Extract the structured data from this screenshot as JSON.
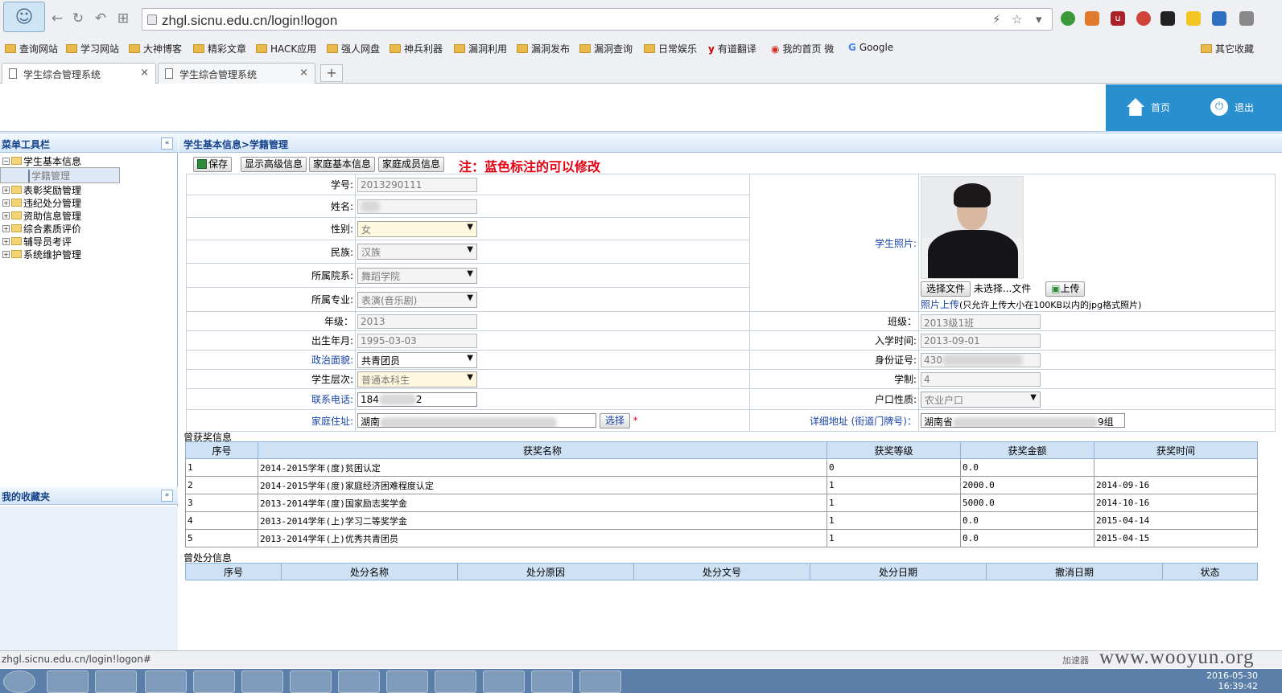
{
  "browser": {
    "url": "zhgl.sicnu.edu.cn/login!logon",
    "bookmarks": [
      "查询网站",
      "学习网站",
      "大神博客",
      "精彩文章",
      "HACK应用",
      "强人网盘",
      "神兵利器",
      "漏洞利用",
      "漏洞发布",
      "漏洞查询",
      "日常娱乐",
      "有道翻译",
      "我的首页 微",
      "Google",
      "其它收藏"
    ],
    "tabs": [
      {
        "title": "学生综合管理系统",
        "close": "×"
      },
      {
        "title": "学生综合管理系统",
        "close": "×"
      }
    ],
    "new_tab": "+"
  },
  "header": {
    "home_label": "首页",
    "logout_label": "退出"
  },
  "sidebar": {
    "title": "菜单工具栏",
    "tree": [
      {
        "label": "学生基本信息",
        "expanded": true,
        "children": [
          {
            "label": "学籍管理"
          }
        ]
      },
      {
        "label": "表彰奖励管理"
      },
      {
        "label": "违纪处分管理"
      },
      {
        "label": "资助信息管理"
      },
      {
        "label": "综合素质评价"
      },
      {
        "label": "辅导员考评"
      },
      {
        "label": "系统维护管理"
      }
    ],
    "favorites_title": "我的收藏夹"
  },
  "main": {
    "breadcrumb": "学生基本信息>学籍管理",
    "toolbar": {
      "save": "保存",
      "advanced": "显示高级信息",
      "family_basic": "家庭基本信息",
      "family_members": "家庭成员信息"
    },
    "note": "注：蓝色标注的可以修改",
    "form": {
      "student_id_label": "学号:",
      "student_id": "2013290111",
      "name_label": "姓名:",
      "gender_label": "性别:",
      "gender": "女",
      "ethnicity_label": "民族:",
      "ethnicity": "汉族",
      "college_label": "所属院系:",
      "college": "舞蹈学院",
      "major_label": "所属专业:",
      "major": "表演(音乐剧)",
      "photo_label": "学生照片:",
      "choose_file": "选择文件",
      "no_file": "未选择...文件",
      "upload": "上传",
      "photo_upload_link": "照片上传",
      "photo_hint": "(只允许上传大小在100KB以内的jpg格式照片)",
      "grade_label": "年级：",
      "grade": "2013",
      "class_label": "班级：",
      "class": "2013级1班",
      "birth_label": "出生年月:",
      "birth": "1995-03-03",
      "enroll_label": "入学时间:",
      "enroll": "2013-09-01",
      "politics_label": "政治面貌:",
      "politics": "共青团员",
      "idcard_label": "身份证号:",
      "idcard": "430",
      "level_label": "学生层次:",
      "level": "普通本科生",
      "duration_label": "学制:",
      "duration": "4",
      "phone_label": "联系电话:",
      "phone_prefix": "184",
      "phone_suffix": "2",
      "hukou_label": "户口性质:",
      "hukou": "农业户口",
      "home_label": "家庭住址:",
      "home_prefix": "湖南",
      "choose": "选择",
      "required": "*",
      "detail_label": "详细地址 (街道门牌号)：",
      "detail_prefix": "湖南省",
      "detail_suffix": "9组"
    },
    "awards": {
      "caption": "曾获奖信息",
      "headers": [
        "序号",
        "获奖名称",
        "获奖等级",
        "获奖金额",
        "获奖时间"
      ],
      "rows": [
        [
          "1",
          "2014-2015学年(度)贫困认定",
          "0",
          "0.0",
          ""
        ],
        [
          "2",
          "2014-2015学年(度)家庭经济困难程度认定",
          "1",
          "2000.0",
          "2014-09-16"
        ],
        [
          "3",
          "2013-2014学年(度)国家励志奖学金",
          "1",
          "5000.0",
          "2014-10-16"
        ],
        [
          "4",
          "2013-2014学年(上)学习二等奖学金",
          "1",
          "0.0",
          "2015-04-14"
        ],
        [
          "5",
          "2013-2014学年(上)优秀共青团员",
          "1",
          "0.0",
          "2015-04-15"
        ]
      ]
    },
    "penalties": {
      "caption": "曾处分信息",
      "headers": [
        "序号",
        "处分名称",
        "处分原因",
        "处分文号",
        "处分日期",
        "撤消日期",
        "状态"
      ]
    }
  },
  "status_bar": {
    "url": "zhgl.sicnu.edu.cn/login!logon#",
    "accelerator": "加速器"
  },
  "watermark": "www.wooyun.org",
  "clock": {
    "date": "2016-05-30",
    "time": "16:39:42"
  }
}
